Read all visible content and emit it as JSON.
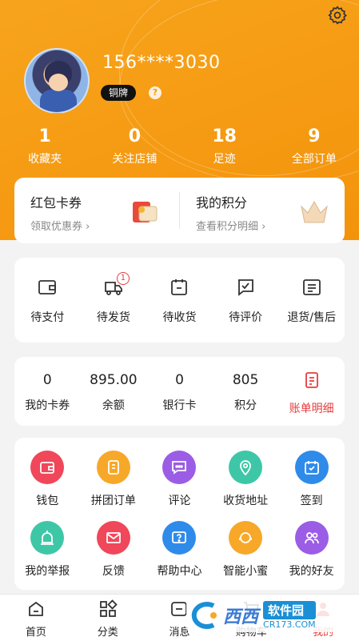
{
  "header": {
    "phone": "156****3030",
    "level": "铜牌",
    "help_symbol": "?",
    "stats": [
      {
        "num": "1",
        "label": "收藏夹"
      },
      {
        "num": "0",
        "label": "关注店铺"
      },
      {
        "num": "18",
        "label": "足迹"
      },
      {
        "num": "9",
        "label": "全部订单"
      }
    ],
    "accent": "#f59a12"
  },
  "promo": {
    "left": {
      "title": "红包卡券",
      "sub": "领取优惠券 ›"
    },
    "right": {
      "title": "我的积分",
      "sub": "查看积分明细 ›"
    }
  },
  "orders": [
    {
      "label": "待支付",
      "icon": "wallet-icon"
    },
    {
      "label": "待发货",
      "icon": "truck-icon",
      "badge": "1"
    },
    {
      "label": "待收货",
      "icon": "calendar-box-icon"
    },
    {
      "label": "待评价",
      "icon": "comment-check-icon"
    },
    {
      "label": "退货/售后",
      "icon": "list-doc-icon"
    }
  ],
  "wallet": [
    {
      "num": "0",
      "label": "我的卡券"
    },
    {
      "num": "895.00",
      "label": "余额"
    },
    {
      "num": "0",
      "label": "银行卡"
    },
    {
      "num": "805",
      "label": "积分"
    },
    {
      "label": "账单明细",
      "icon": "bill-icon"
    }
  ],
  "services": [
    {
      "label": "钱包",
      "color": "#f0475a",
      "icon": "wallet-icon"
    },
    {
      "label": "拼团订单",
      "color": "#f7a829",
      "icon": "group-order-icon"
    },
    {
      "label": "评论",
      "color": "#9b5de5",
      "icon": "chat-icon"
    },
    {
      "label": "收货地址",
      "color": "#3ec7a7",
      "icon": "location-icon"
    },
    {
      "label": "签到",
      "color": "#2f8bea",
      "icon": "checkin-calendar-icon"
    },
    {
      "label": "我的举报",
      "color": "#3ec7a7",
      "icon": "alarm-icon"
    },
    {
      "label": "反馈",
      "color": "#f0475a",
      "icon": "mail-icon"
    },
    {
      "label": "帮助中心",
      "color": "#2f8bea",
      "icon": "help-icon"
    },
    {
      "label": "智能小蜜",
      "color": "#f7a829",
      "icon": "assistant-icon"
    },
    {
      "label": "我的好友",
      "color": "#9b5de5",
      "icon": "friends-icon"
    }
  ],
  "tabs": [
    {
      "label": "首页",
      "icon": "home-icon"
    },
    {
      "label": "分类",
      "icon": "category-icon"
    },
    {
      "label": "消息",
      "icon": "message-icon"
    },
    {
      "label": "购物车",
      "icon": "cart-icon"
    },
    {
      "label": "我的",
      "icon": "profile-icon",
      "active": true
    }
  ],
  "watermark": {
    "brand": "西西",
    "name": "软件园",
    "site": "CR173.COM"
  }
}
